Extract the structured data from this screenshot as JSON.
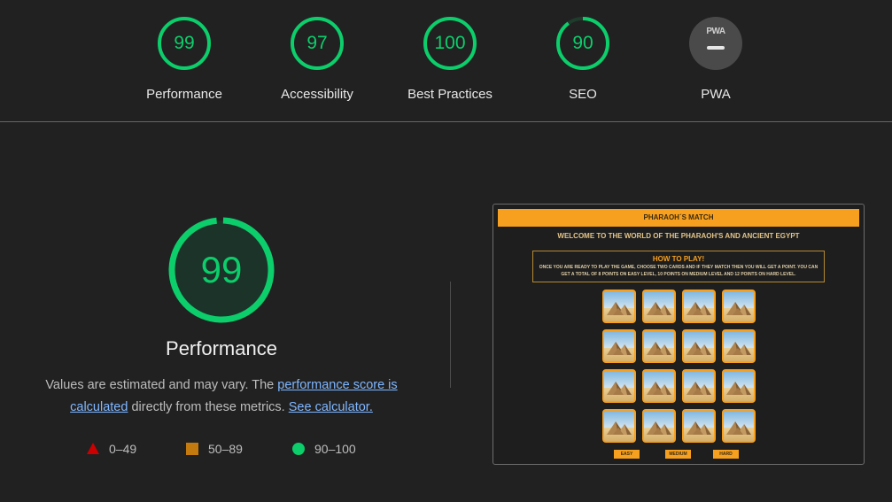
{
  "categories": [
    {
      "name": "Performance",
      "score": 99
    },
    {
      "name": "Accessibility",
      "score": 97
    },
    {
      "name": "Best Practices",
      "score": 100
    },
    {
      "name": "SEO",
      "score": 90
    },
    {
      "name": "PWA",
      "badge_text": "PWA"
    }
  ],
  "main": {
    "score": 99,
    "title": "Performance",
    "desc_part1": "Values are estimated and may vary. The ",
    "link_score": "performance score is calculated",
    "desc_part2": " directly from these metrics. ",
    "link_calc": "See calculator."
  },
  "legend": [
    {
      "label": "0–49",
      "shape": "triangle",
      "color": "#cc0000"
    },
    {
      "label": "50–89",
      "shape": "square",
      "color": "#c47a0e"
    },
    {
      "label": "90–100",
      "shape": "circle",
      "color": "#0cce6b"
    }
  ],
  "thumbnail": {
    "header": "PHARAOH´S MATCH",
    "welcome": "WELCOME TO THE WORLD OF THE PHARAOH'S AND ANCIENT EGYPT",
    "howto_title": "HOW TO PLAY!",
    "howto_text": "ONCE YOU ARE READY TO PLAY THE GAME, CHOOSE TWO CARDS AND IF THEY MATCH THEN YOU WILL GET A POINT. YOU CAN GET A TOTAL OF 8 POINTS ON EASY LEVEL, 10 POINTS ON MEDIUM LEVEL AND 12 POINTS ON HARD LEVEL.",
    "buttons": [
      "EASY",
      "MEDIUM",
      "HARD"
    ],
    "card_icon": "pyramids-icon",
    "card_count": 16
  },
  "colors": {
    "pass": "#0cce6b",
    "average": "#c47a0e",
    "fail": "#cc0000",
    "background": "#212121",
    "link": "#80b7ff",
    "game_accent": "#f7a01f"
  }
}
